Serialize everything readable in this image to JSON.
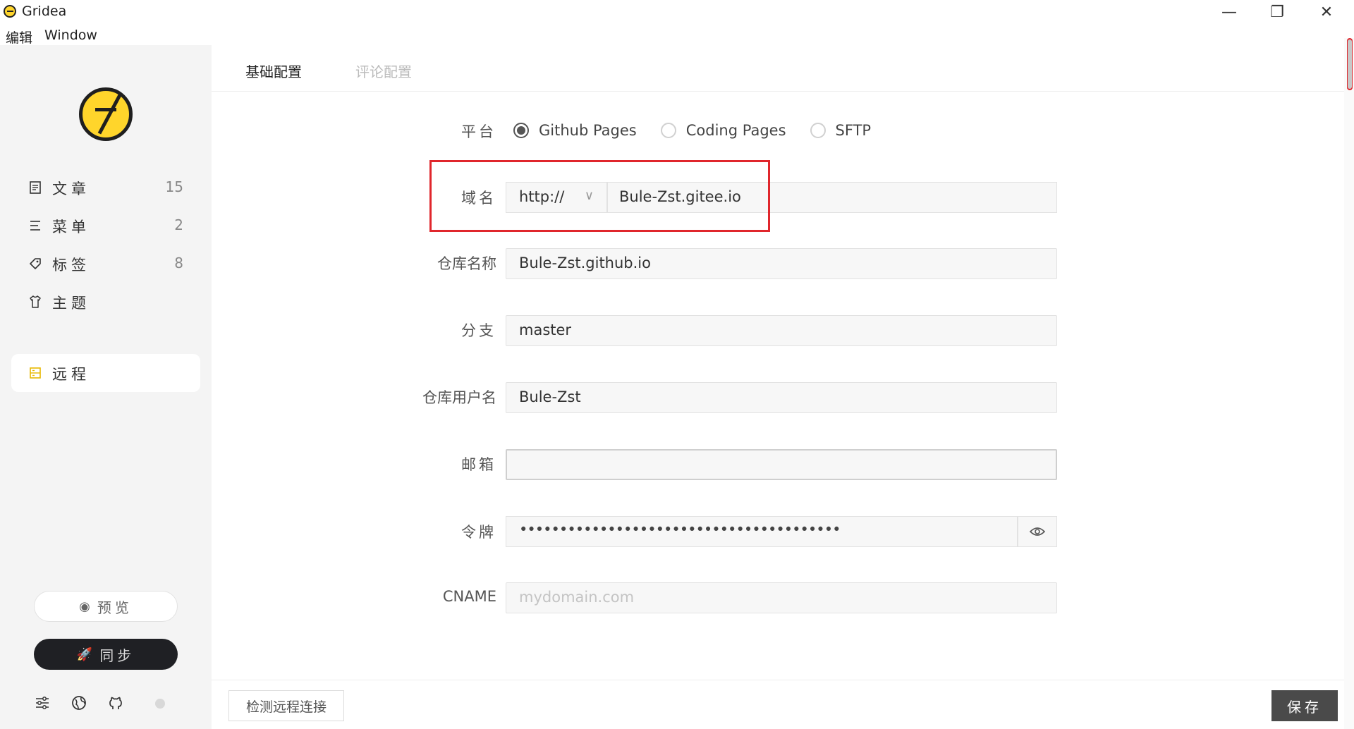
{
  "app": {
    "title": "Gridea",
    "menu": [
      "编辑",
      "Window"
    ],
    "window_controls": {
      "minimize": "—",
      "maximize": "❐",
      "close": "✕"
    }
  },
  "sidebar": {
    "items": [
      {
        "label": "文章",
        "count": "15",
        "icon": "document-icon",
        "active": false
      },
      {
        "label": "菜单",
        "count": "2",
        "icon": "menu-icon",
        "active": false
      },
      {
        "label": "标签",
        "count": "8",
        "icon": "tag-icon",
        "active": false
      },
      {
        "label": "主题",
        "count": "",
        "icon": "shirt-icon",
        "active": false
      },
      {
        "label": "远程",
        "count": "",
        "icon": "server-icon",
        "active": true
      }
    ],
    "preview_label": "预览",
    "sync_label": "同步",
    "footer_icons": [
      "settings-sliders-icon",
      "globe-icon",
      "github-icon"
    ]
  },
  "tabs": [
    {
      "label": "基础配置",
      "active": true
    },
    {
      "label": "评论配置",
      "active": false
    }
  ],
  "form": {
    "platform": {
      "label": "平台",
      "options": [
        "Github Pages",
        "Coding Pages",
        "SFTP"
      ],
      "selected": "Github Pages"
    },
    "domain": {
      "label": "域名",
      "protocol": "http://",
      "value": "Bule-Zst.gitee.io"
    },
    "repo_name": {
      "label": "仓库名称",
      "value": "Bule-Zst.github.io"
    },
    "branch": {
      "label": "分支",
      "value": "master"
    },
    "repo_user": {
      "label": "仓库用户名",
      "value": "Bule-Zst"
    },
    "email": {
      "label": "邮箱",
      "value": ""
    },
    "token": {
      "label": "令牌",
      "value": "••••••••••••••••••••••••••••••••••••••••"
    },
    "cname": {
      "label": "CNAME",
      "value": "",
      "placeholder": "mydomain.com"
    }
  },
  "footer": {
    "check_label": "检测远程连接",
    "save_label": "保存"
  },
  "colors": {
    "sidebar_bg": "#f4f4f4",
    "logo_yellow": "#ffd52b",
    "sync_button": "#1f2024",
    "save_button": "#4a4a4a",
    "highlight": "#e0262c"
  }
}
